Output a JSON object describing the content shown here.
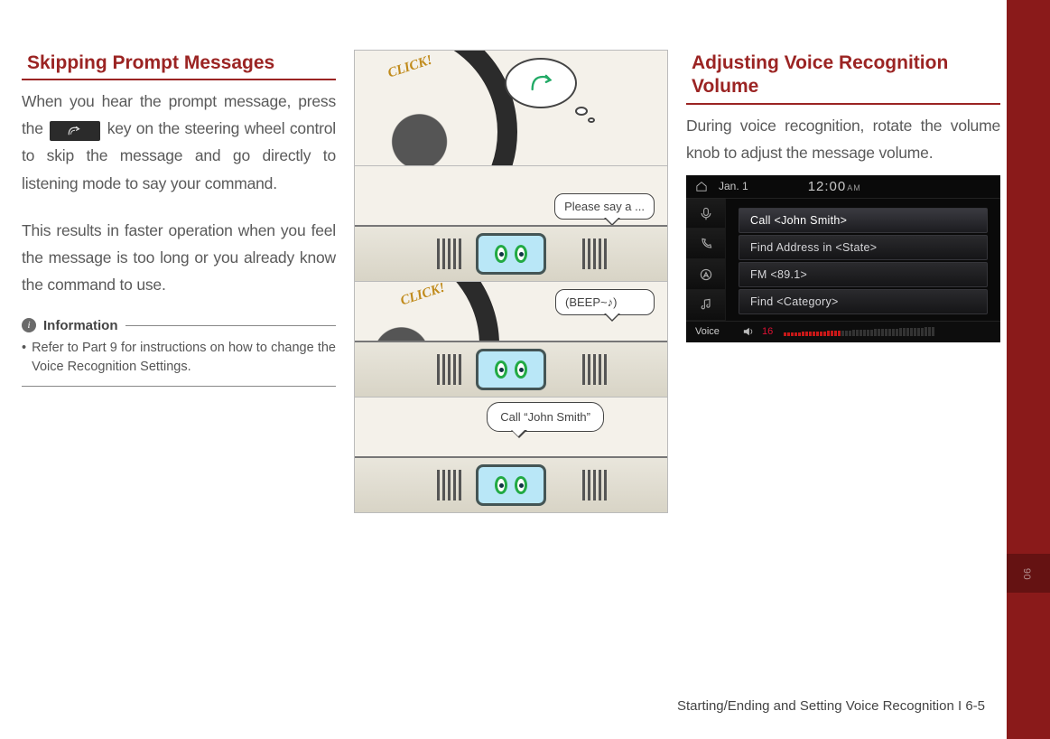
{
  "left": {
    "heading": "Skipping Prompt Messages",
    "p1a": "When you hear the prompt message, press the ",
    "p1b": " key on the steering wheel control to skip the message and go directly to listening mode to say your com­mand.",
    "p2": "This results in faster operation when you feel the message is too long or you already know the command to use.",
    "info_label": "Information",
    "info_bullet": "Refer to Part 9 for instructions on how to change the Voice Recognition Settings."
  },
  "comic": {
    "click": "CLICK!",
    "bubble1": "Please say a ...",
    "bubble2": "(BEEP~♪)",
    "bubble3": "Call “John Smith”"
  },
  "right": {
    "heading": "Adjusting Voice Recognition Volume",
    "p1": "During voice recognition, rotate the vol­ume knob to adjust the message volume."
  },
  "infoshot": {
    "date": "Jan.  1",
    "time": "12:00",
    "ampm": "AM",
    "items": [
      "Call <John Smith>",
      "Find Address in <State>",
      "FM <89.1>",
      "Find <Category>"
    ],
    "bottom_label": "Voice",
    "vol_number": "16",
    "vol_active": 16,
    "vol_total": 42
  },
  "footer": "Starting/Ending and Setting Voice Recognition I 6-5",
  "side_chip": "06"
}
